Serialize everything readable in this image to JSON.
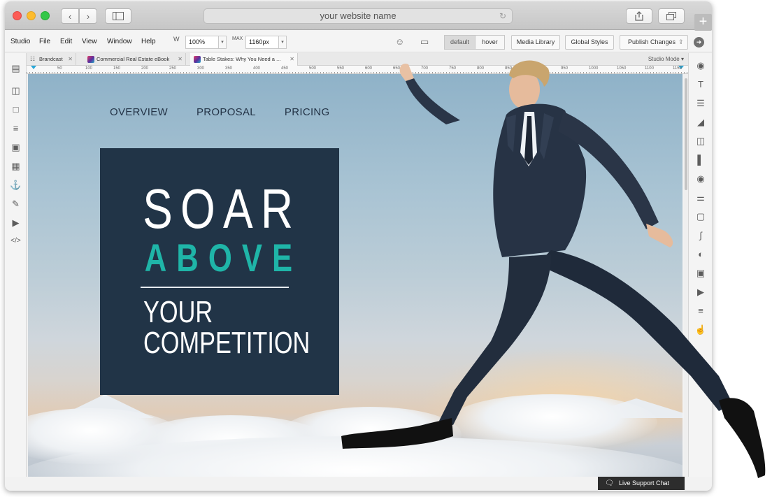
{
  "browser": {
    "address": "your website name"
  },
  "menubar": {
    "items": [
      "Studio",
      "File",
      "Edit",
      "View",
      "Window",
      "Help"
    ],
    "width_label": "W",
    "width_value": "100%",
    "max_label": "MAX",
    "max_value": "1160px",
    "state_default": "default",
    "state_hover": "hover",
    "media_library": "Media Library",
    "global_styles": "Global Styles",
    "publish": "Publish Changes"
  },
  "doc_tabs": {
    "tabs": [
      "Brandcast",
      "Commercial Real Estate eBook",
      "Table Stakes: Why You Need a ..."
    ],
    "mode": "Studio Mode"
  },
  "ruler": {
    "marks": [
      "50",
      "100",
      "150",
      "200",
      "250",
      "300",
      "350",
      "400",
      "450",
      "500",
      "550",
      "600",
      "650",
      "700",
      "750",
      "800",
      "850",
      "900",
      "950",
      "1000",
      "1050",
      "1100",
      "1150"
    ]
  },
  "site": {
    "nav": [
      "OVERVIEW",
      "PROPOSAL",
      "PRICING"
    ],
    "hero_line1": "SOAR",
    "hero_line2": "ABOVE",
    "hero_line3": "YOUR",
    "hero_line4": "COMPETITION"
  },
  "support": {
    "label": "Live Support Chat"
  },
  "colors": {
    "hero_box": "#213447",
    "accent": "#1fb5a8",
    "nav_text": "#243447"
  }
}
